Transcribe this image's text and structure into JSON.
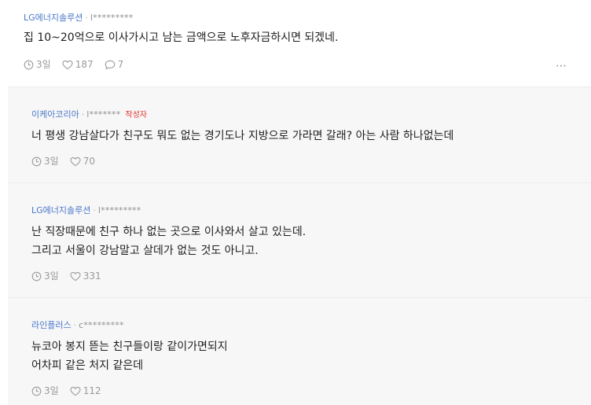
{
  "comments": [
    {
      "company": "LG에너지솔루션",
      "user": "l*********",
      "lines": [
        "집 10~20억으로 이사가시고 남는 금액으로 노후자금하시면 되겠네."
      ],
      "time": "3일",
      "likes": "187",
      "replies": "7",
      "more_icon": "⋯"
    }
  ],
  "replies": [
    {
      "company": "이케아코리아",
      "user": "l*******",
      "author_tag": "작성자",
      "lines": [
        "너 평생 강남살다가 친구도 뭐도 없는 경기도나 지방으로 가라면 갈래? 아는 사람 하나없는데"
      ],
      "time": "3일",
      "likes": "70"
    },
    {
      "company": "LG에너지솔루션",
      "user": "l*********",
      "lines": [
        "난 직장때문에 친구 하나 없는 곳으로 이사와서 살고 있는데.",
        "그리고 서울이 강남말고 살데가 없는 것도 아니고."
      ],
      "time": "3일",
      "likes": "331"
    },
    {
      "company": "라인플러스",
      "user": "c*********",
      "lines": [
        "뉴코아 봉지 뜯는 친구들이랑 같이가면되지",
        "어차피 같은 처지 같은데"
      ],
      "time": "3일",
      "likes": "112"
    }
  ],
  "separator": "·",
  "icons": {
    "time": "clock-icon",
    "likes": "heart-icon",
    "replies": "speech-bubble-icon",
    "more": "more-dots-icon"
  },
  "colors": {
    "company": "#4a78c8",
    "author_tag": "#e0332b",
    "reply_bg": "#f7f7f8",
    "meta": "#9a9a9a"
  }
}
